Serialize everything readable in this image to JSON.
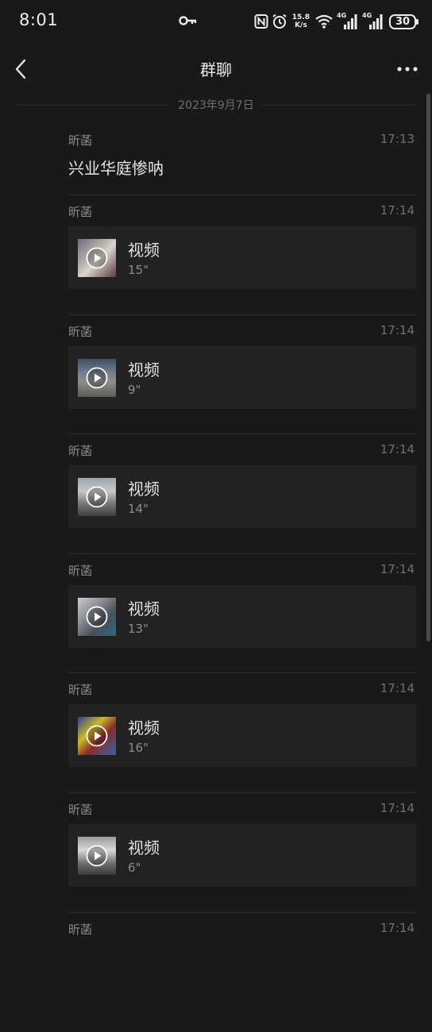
{
  "status_bar": {
    "time": "8:01",
    "net_speed_value": "15.8",
    "net_speed_unit": "K/s",
    "signal_1_label": "4G",
    "signal_2_label": "4G",
    "battery": "30"
  },
  "nav": {
    "title": "群聊"
  },
  "date_divider": "2023年9月7日",
  "messages": [
    {
      "sender": "昕菡",
      "time": "17:13",
      "text": "兴业华庭惨呐"
    },
    {
      "sender": "昕菡",
      "time": "17:14",
      "video_label": "视频",
      "duration": "15\""
    },
    {
      "sender": "昕菡",
      "time": "17:14",
      "video_label": "视频",
      "duration": "9\""
    },
    {
      "sender": "昕菡",
      "time": "17:14",
      "video_label": "视频",
      "duration": "14\""
    },
    {
      "sender": "昕菡",
      "time": "17:14",
      "video_label": "视频",
      "duration": "13\""
    },
    {
      "sender": "昕菡",
      "time": "17:14",
      "video_label": "视频",
      "duration": "16\""
    },
    {
      "sender": "昕菡",
      "time": "17:14",
      "video_label": "视频",
      "duration": "6\""
    },
    {
      "sender": "昕菡",
      "time": "17:14"
    }
  ]
}
